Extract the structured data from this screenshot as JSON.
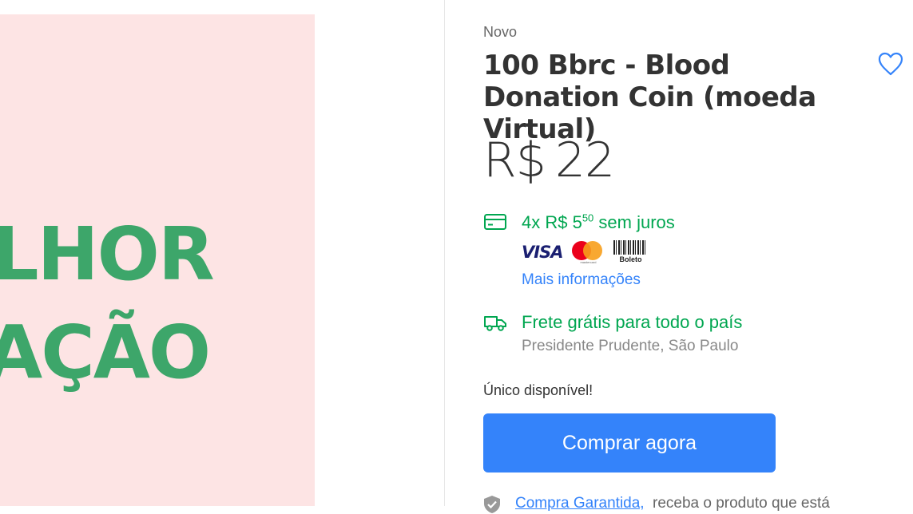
{
  "product_image": {
    "line1": "LHOR",
    "line2": "AÇÃO"
  },
  "product": {
    "condition": "Novo",
    "title": "100 Bbrc - Blood Donation Coin (moeda Virtual)",
    "price_currency": "R$",
    "price_value": "22"
  },
  "payment": {
    "installments_prefix": "4x R$ 5",
    "installments_cents": "50",
    "installments_suffix": "sem juros",
    "methods": [
      "VISA",
      "mastercard",
      "Boleto"
    ],
    "more_info": "Mais informações"
  },
  "shipping": {
    "title": "Frete grátis para todo o país",
    "location": "Presidente Prudente, São Paulo"
  },
  "stock": "Único disponível!",
  "buy_button": "Comprar agora",
  "guarantee": {
    "link": "Compra Garantida,",
    "text": "receba o produto que está"
  },
  "colors": {
    "accent": "#3483fa",
    "green": "#00a650",
    "image_bg": "#fde4e4",
    "image_text": "#3da66a"
  },
  "icons": [
    "heart-icon",
    "credit-card-icon",
    "truck-icon",
    "shield-icon"
  ]
}
